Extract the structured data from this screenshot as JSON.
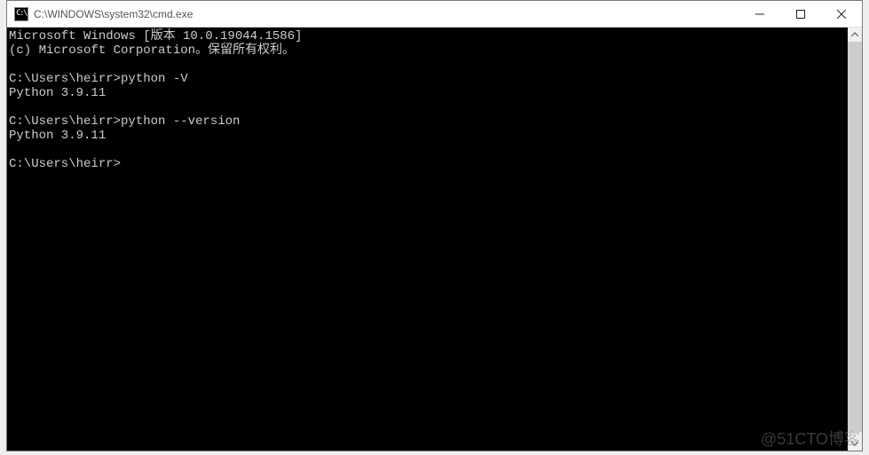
{
  "window": {
    "icon_label": "C:\\",
    "title": "C:\\WINDOWS\\system32\\cmd.exe"
  },
  "terminal": {
    "lines": [
      "Microsoft Windows [版本 10.0.19044.1586]",
      "(c) Microsoft Corporation。保留所有权利。",
      "",
      "C:\\Users\\heirr>python -V",
      "Python 3.9.11",
      "",
      "C:\\Users\\heirr>python --version",
      "Python 3.9.11",
      "",
      "C:\\Users\\heirr>"
    ]
  },
  "watermark": "@51CTO博客"
}
